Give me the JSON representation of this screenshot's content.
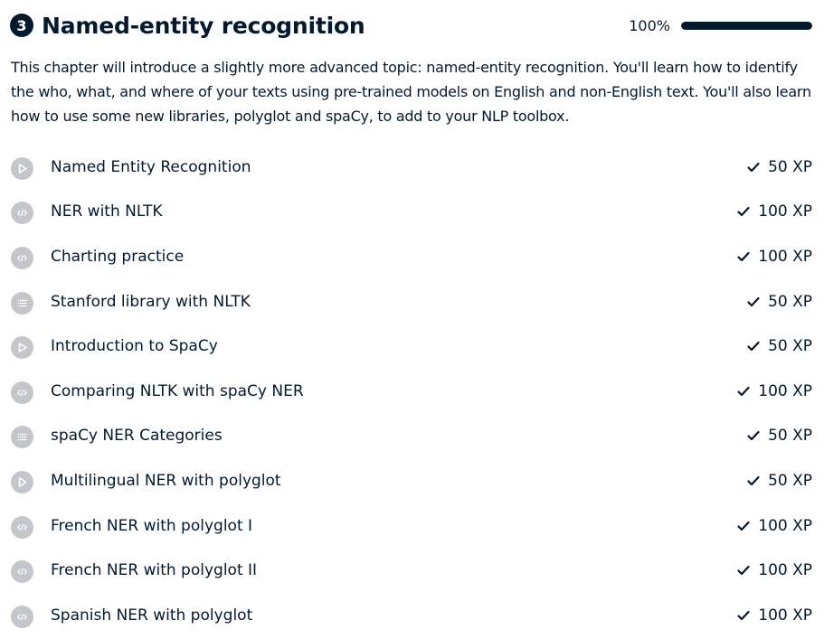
{
  "chapter": {
    "number": "3",
    "title": "Named-entity recognition",
    "progress_label": "100%",
    "progress_fraction": 1.0,
    "description": "This chapter will introduce a slightly more advanced topic: named-entity recognition. You'll learn how to identify the who, what, and where of your texts using pre-trained models on English and non-English text. You'll also learn how to use some new libraries, polyglot and spaCy, to add to your NLP toolbox."
  },
  "colors": {
    "text": "#05192d",
    "icon_bg": "#c4c6cc",
    "progress_fill": "#05192d",
    "progress_track": "#e8e8ea"
  },
  "exercises": [
    {
      "title": "Named Entity Recognition",
      "xp": "50 XP",
      "icon": "play-icon"
    },
    {
      "title": "NER with NLTK",
      "xp": "100 XP",
      "icon": "code-icon"
    },
    {
      "title": "Charting practice",
      "xp": "100 XP",
      "icon": "code-icon"
    },
    {
      "title": "Stanford library with NLTK",
      "xp": "50 XP",
      "icon": "list-icon"
    },
    {
      "title": "Introduction to SpaCy",
      "xp": "50 XP",
      "icon": "play-icon"
    },
    {
      "title": "Comparing NLTK with spaCy NER",
      "xp": "100 XP",
      "icon": "code-icon"
    },
    {
      "title": "spaCy NER Categories",
      "xp": "50 XP",
      "icon": "list-icon"
    },
    {
      "title": "Multilingual NER with polyglot",
      "xp": "50 XP",
      "icon": "play-icon"
    },
    {
      "title": "French NER with polyglot I",
      "xp": "100 XP",
      "icon": "code-icon"
    },
    {
      "title": "French NER with polyglot II",
      "xp": "100 XP",
      "icon": "code-icon"
    },
    {
      "title": "Spanish NER with polyglot",
      "xp": "100 XP",
      "icon": "code-icon"
    }
  ]
}
